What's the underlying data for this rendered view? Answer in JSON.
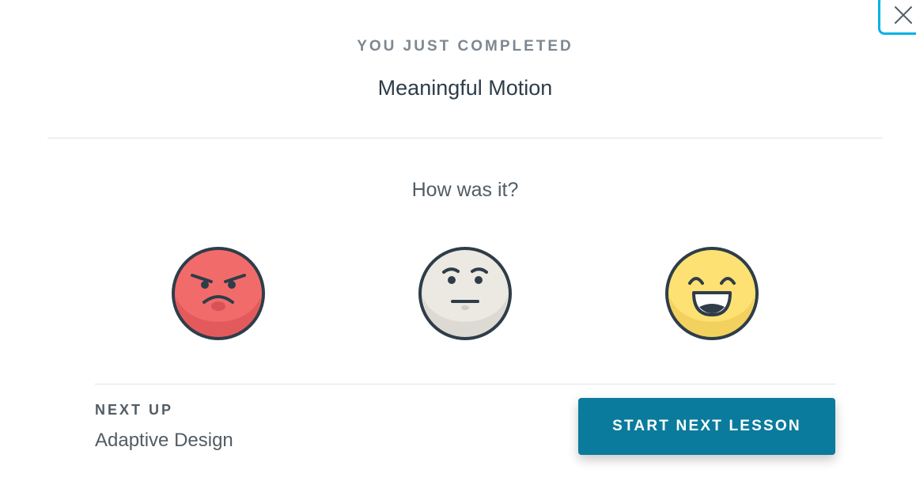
{
  "close": {
    "icon": "close-icon"
  },
  "header": {
    "eyebrow": "YOU JUST COMPLETED",
    "lesson_title": "Meaningful Motion"
  },
  "rating": {
    "question": "How was it?",
    "options": [
      {
        "name": "angry",
        "icon": "angry-face-icon",
        "color": "#f26b6b"
      },
      {
        "name": "neutral",
        "icon": "neutral-face-icon",
        "color": "#ebe9e2"
      },
      {
        "name": "happy",
        "icon": "happy-face-icon",
        "color": "#fde172"
      }
    ]
  },
  "next": {
    "label": "NEXT UP",
    "title": "Adaptive Design",
    "button_label": "START NEXT LESSON"
  },
  "colors": {
    "accent": "#02b3e4",
    "button": "#0a7b9c",
    "outline": "#2e3d49"
  }
}
